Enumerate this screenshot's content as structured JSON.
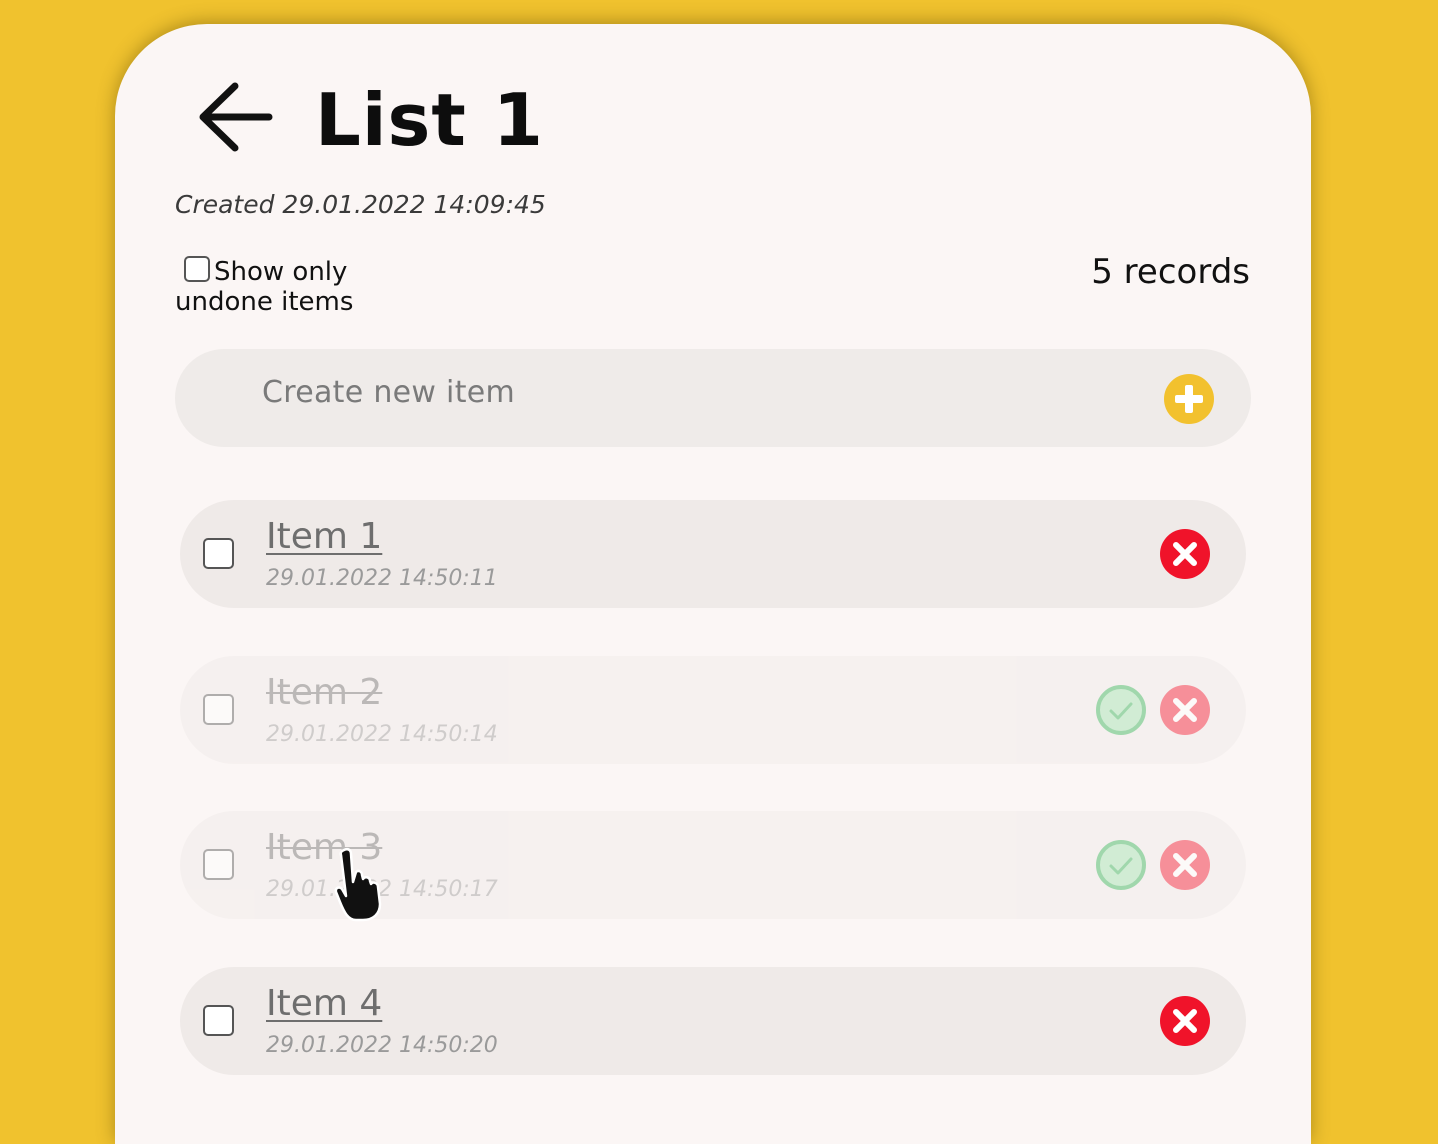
{
  "header": {
    "title": "List 1",
    "created": "Created 29.01.2022 14:09:45"
  },
  "filter": {
    "label_line1": "Show only",
    "label_line2": "undone items",
    "checked": false
  },
  "records_count": "5 records",
  "new_item": {
    "placeholder": "Create new item"
  },
  "items": [
    {
      "name": "Item 1",
      "date": "29.01.2022 14:50:11",
      "done": false
    },
    {
      "name": "Item 2",
      "date": "29.01.2022 14:50:14",
      "done": true
    },
    {
      "name": "Item 3",
      "date": "29.01.2022 14:50:17",
      "done": true
    },
    {
      "name": "Item 4",
      "date": "29.01.2022 14:50:20",
      "done": false
    }
  ],
  "colors": {
    "background": "#f0c22e",
    "card": "#fbf6f5",
    "row": "#efeae8",
    "add_accent": "#f2c12e",
    "delete_red": "#f0132a",
    "done_green": "#bfe8c8"
  },
  "icons": {
    "back": "arrow-left-icon",
    "add": "plus-circle-icon",
    "delete": "x-circle-icon",
    "done": "check-circle-icon",
    "cursor": "hand-pointer-icon"
  }
}
